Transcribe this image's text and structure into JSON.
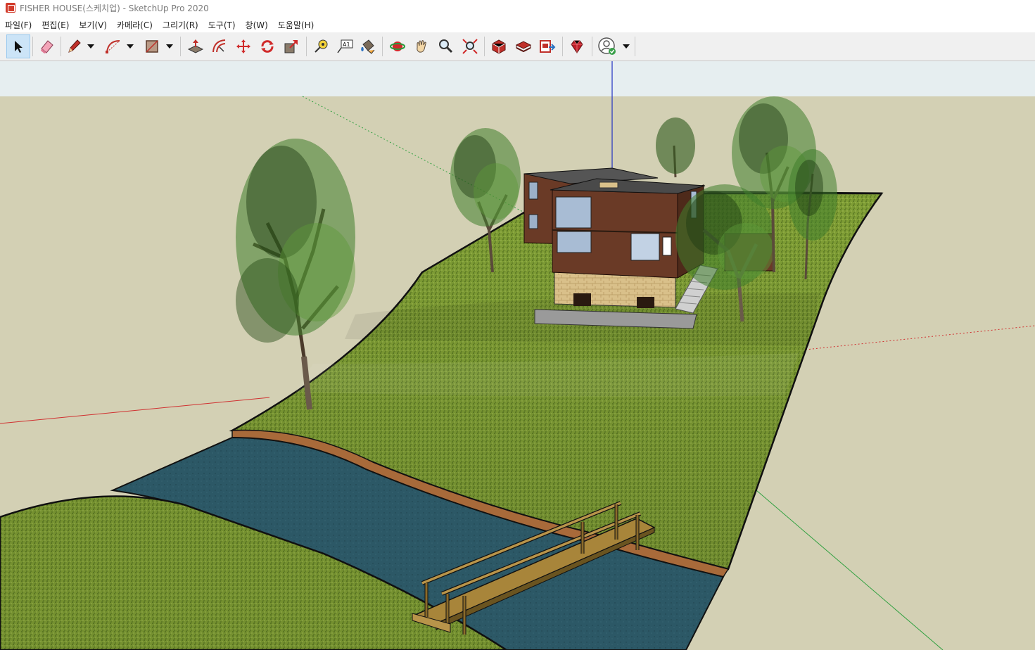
{
  "window": {
    "title": "FISHER HOUSE(스케치업) - SketchUp Pro 2020"
  },
  "menu": {
    "items": [
      {
        "label": "파일(F)"
      },
      {
        "label": "편집(E)"
      },
      {
        "label": "보기(V)"
      },
      {
        "label": "카메라(C)"
      },
      {
        "label": "그리기(R)"
      },
      {
        "label": "도구(T)"
      },
      {
        "label": "창(W)"
      },
      {
        "label": "도움말(H)"
      }
    ]
  },
  "toolbar": {
    "tools": [
      "select-icon",
      "eraser-icon",
      "pencil-line-icon",
      "arc-icon",
      "rectangle-icon",
      "push-pull-icon",
      "offset-icon",
      "move-icon",
      "rotate-icon",
      "scale-icon",
      "tape-measure-icon",
      "text-icon",
      "paint-bucket-icon",
      "orbit-icon",
      "pan-icon",
      "zoom-icon",
      "zoom-extents-icon",
      "warehouse-icon",
      "extension-warehouse-icon",
      "layout-icon",
      "ruby-icon",
      "account-icon"
    ],
    "text_tool_label": "A1",
    "accent": "#99c9ef"
  },
  "scene": {
    "sky_color": "#e6eef0",
    "ground_color": "#d3d0b4",
    "grass_color": "#7a9b33",
    "water_color": "#2b5561",
    "house_wall_color": "#6a3a26",
    "stone_color": "#d8c08a"
  }
}
